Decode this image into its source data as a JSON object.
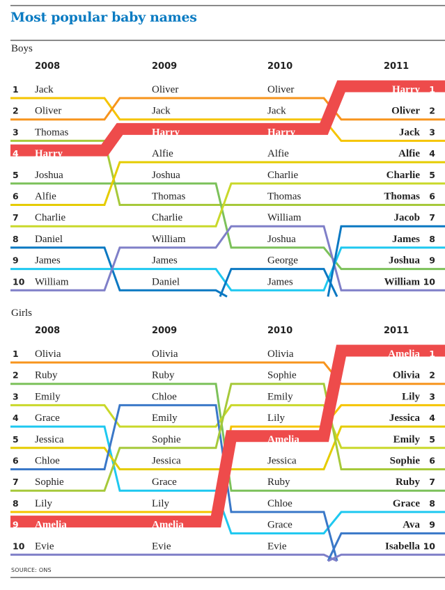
{
  "title": "Most popular baby names",
  "source": "SOURCE: ONS",
  "chart_data": {
    "type": "bump",
    "title": "Most popular baby names",
    "years": [
      "2008",
      "2009",
      "2010",
      "2011"
    ],
    "source": "SOURCE: ONS",
    "groups": [
      {
        "label": "Boys",
        "highlight": "Harry",
        "rankings": {
          "2008": [
            "Jack",
            "Oliver",
            "Thomas",
            "Harry",
            "Joshua",
            "Alfie",
            "Charlie",
            "Daniel",
            "James",
            "William"
          ],
          "2009": [
            "Oliver",
            "Jack",
            "Harry",
            "Alfie",
            "Joshua",
            "Thomas",
            "Charlie",
            "William",
            "James",
            "Daniel"
          ],
          "2010": [
            "Oliver",
            "Jack",
            "Harry",
            "Alfie",
            "Charlie",
            "Thomas",
            "William",
            "Joshua",
            "George",
            "James"
          ],
          "2011": [
            "Harry",
            "Oliver",
            "Jack",
            "Alfie",
            "Charlie",
            "Thomas",
            "Jacob",
            "James",
            "Joshua",
            "William"
          ]
        },
        "colors": {
          "Jack": "#f5c400",
          "Oliver": "#f7941d",
          "Thomas": "#a6c93a",
          "Harry": "#ee4b4b",
          "Joshua": "#7cc15a",
          "Alfie": "#e5cc00",
          "Charlie": "#c9d82a",
          "Daniel": "#0a78c2",
          "James": "#1ec8f0",
          "William": "#7f7fc8",
          "George": "#0a78c2",
          "Jacob": "#0a78c2"
        }
      },
      {
        "label": "Girls",
        "highlight": "Amelia",
        "rankings": {
          "2008": [
            "Olivia",
            "Ruby",
            "Emily",
            "Grace",
            "Jessica",
            "Chloe",
            "Sophie",
            "Lily",
            "Amelia",
            "Evie"
          ],
          "2009": [
            "Olivia",
            "Ruby",
            "Chloe",
            "Emily",
            "Sophie",
            "Jessica",
            "Grace",
            "Lily",
            "Amelia",
            "Evie"
          ],
          "2010": [
            "Olivia",
            "Sophie",
            "Emily",
            "Lily",
            "Amelia",
            "Jessica",
            "Ruby",
            "Chloe",
            "Grace",
            "Evie"
          ],
          "2011": [
            "Amelia",
            "Olivia",
            "Lily",
            "Jessica",
            "Emily",
            "Sophie",
            "Ruby",
            "Grace",
            "Ava",
            "Isabella"
          ]
        },
        "colors": {
          "Olivia": "#f7941d",
          "Ruby": "#7cc15a",
          "Emily": "#c9d82a",
          "Grace": "#1ec8f0",
          "Jessica": "#e5cc00",
          "Chloe": "#3a78c8",
          "Sophie": "#a6c93a",
          "Lily": "#f5c400",
          "Amelia": "#ee4b4b",
          "Evie": "#7f7fc8",
          "Ava": "#3a78c8",
          "Isabella": "#7f7fc8"
        }
      }
    ]
  }
}
